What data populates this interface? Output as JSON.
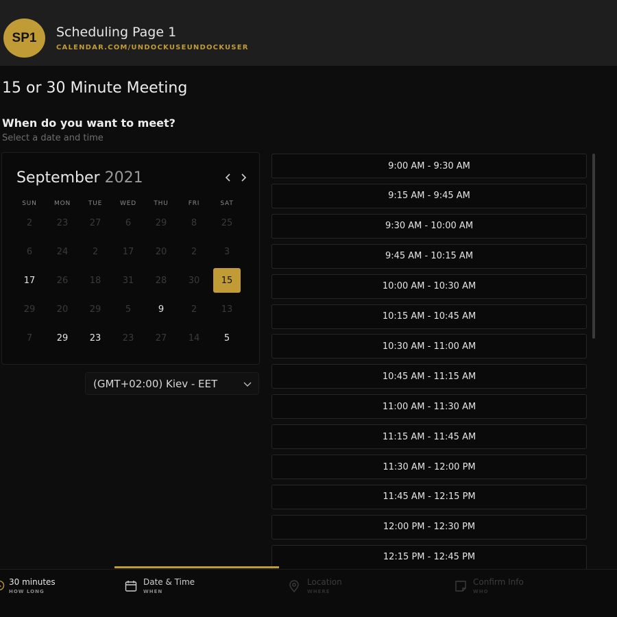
{
  "header": {
    "avatar_initials": "SP1",
    "page_name": "Scheduling Page 1",
    "page_url": "CALENDAR.COM/UNDOCKUSEUNDOCKUSER"
  },
  "event_title": "15 or 30 Minute Meeting",
  "section": {
    "title": "When do you want to meet?",
    "subtitle": "Select a date and time"
  },
  "calendar": {
    "month": "September",
    "year": "2021",
    "prev_icon": "chevron-left-icon",
    "next_icon": "chevron-right-icon",
    "weekdays": [
      "SUN",
      "MON",
      "TUE",
      "WED",
      "THU",
      "FRI",
      "SAT"
    ],
    "weeks": [
      [
        {
          "d": "2",
          "a": false
        },
        {
          "d": "23",
          "a": false
        },
        {
          "d": "27",
          "a": false
        },
        {
          "d": "6",
          "a": false
        },
        {
          "d": "29",
          "a": false
        },
        {
          "d": "8",
          "a": false
        },
        {
          "d": "25",
          "a": false
        }
      ],
      [
        {
          "d": "6",
          "a": false
        },
        {
          "d": "24",
          "a": false
        },
        {
          "d": "2",
          "a": false
        },
        {
          "d": "17",
          "a": false
        },
        {
          "d": "20",
          "a": false
        },
        {
          "d": "2",
          "a": false
        },
        {
          "d": "3",
          "a": false
        }
      ],
      [
        {
          "d": "17",
          "a": true
        },
        {
          "d": "26",
          "a": false
        },
        {
          "d": "18",
          "a": false
        },
        {
          "d": "31",
          "a": false
        },
        {
          "d": "28",
          "a": false
        },
        {
          "d": "30",
          "a": false
        },
        {
          "d": "15",
          "a": true,
          "selected": true
        }
      ],
      [
        {
          "d": "29",
          "a": false
        },
        {
          "d": "20",
          "a": false
        },
        {
          "d": "29",
          "a": false
        },
        {
          "d": "5",
          "a": false
        },
        {
          "d": "9",
          "a": true
        },
        {
          "d": "2",
          "a": false
        },
        {
          "d": "13",
          "a": false
        }
      ],
      [
        {
          "d": "7",
          "a": false
        },
        {
          "d": "29",
          "a": true
        },
        {
          "d": "23",
          "a": true
        },
        {
          "d": "23",
          "a": false
        },
        {
          "d": "27",
          "a": false
        },
        {
          "d": "14",
          "a": false
        },
        {
          "d": "5",
          "a": true
        }
      ]
    ],
    "colors": {
      "accent": "#c19b36",
      "available": "#e6e6e6",
      "unavailable": "#3a3a3a"
    }
  },
  "timezone": {
    "value": "(GMT+02:00) Kiev - EET",
    "icon": "chevron-down-icon"
  },
  "time_slots": [
    "9:00 AM - 9:30 AM",
    "9:15 AM - 9:45 AM",
    "9:30 AM - 10:00 AM",
    "9:45 AM - 10:15 AM",
    "10:00 AM - 10:30 AM",
    "10:15 AM - 10:45 AM",
    "10:30 AM - 11:00 AM",
    "10:45 AM - 11:15 AM",
    "11:00 AM - 11:30 AM",
    "11:15 AM - 11:45 AM",
    "11:30 AM - 12:00 PM",
    "11:45 AM - 12:15 PM",
    "12:00 PM - 12:30 PM",
    "12:15 PM - 12:45 PM"
  ],
  "steps": [
    {
      "label": "30 minutes",
      "sub": "HOW LONG",
      "icon": "clock-icon",
      "state": "done"
    },
    {
      "label": "Date & Time",
      "sub": "WHEN",
      "icon": "calendar-icon",
      "state": "active"
    },
    {
      "label": "Location",
      "sub": "WHERE",
      "icon": "location-pin-icon",
      "state": "disabled"
    },
    {
      "label": "Confirm Info",
      "sub": "WHO",
      "icon": "note-icon",
      "state": "disabled"
    }
  ]
}
